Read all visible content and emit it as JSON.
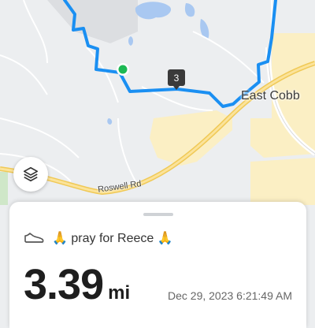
{
  "map": {
    "place_label": "East Cobb",
    "road_label": "Roswell Rd",
    "lap_marker": "3",
    "route_color": "#1a8ff2",
    "start_color": "#1db954"
  },
  "activity": {
    "icon": "shoe-icon",
    "name": "🙏 pray for Reece 🙏",
    "distance_value": "3.39",
    "distance_unit": "mi",
    "timestamp": "Dec 29, 2023 6:21:49 AM"
  },
  "controls": {
    "layers_icon": "layers-icon"
  }
}
